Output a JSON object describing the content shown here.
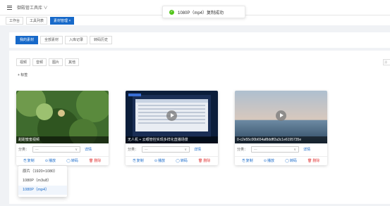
{
  "app": {
    "title": "御殿管工具库 ∨"
  },
  "toast": {
    "icon": "check-circle-icon",
    "text": "1080P（mp4）复制成功"
  },
  "tabs": [
    {
      "label": "工作台",
      "active": false
    },
    {
      "label": "工具列表",
      "active": false
    },
    {
      "label": "素材管理 ×",
      "active": true
    }
  ],
  "subtabs": [
    {
      "label": "我的素材",
      "active": true
    },
    {
      "label": "全部素材",
      "active": false
    },
    {
      "label": "入库记录",
      "active": false
    },
    {
      "label": "转码历史",
      "active": false
    }
  ],
  "filters": [
    "视频",
    "音频",
    "图片",
    "其他"
  ],
  "search_edge": "添",
  "tag_button": "+ 标签",
  "cards": [
    {
      "caption": "甜甜蜜蜜视频",
      "class_label": "分类：",
      "select_value": "—",
      "detail": "详情"
    },
    {
      "caption": "无人机 + 云眼管控实现多样化直播场景",
      "class_label": "分类：",
      "select_value": "—",
      "detail": "详情"
    },
    {
      "caption": "0-c2e55c00b654af8ddff2a3c1e6195735e",
      "class_label": "分类：",
      "select_value": "—",
      "detail": "详情"
    }
  ],
  "actions": {
    "copy": "复制",
    "play": "播放",
    "transcode": "转码",
    "delete": "删除"
  },
  "dropdown": [
    {
      "label": "原片（1920×1080）",
      "selected": false
    },
    {
      "label": "1080P（m3u8）",
      "selected": false
    },
    {
      "label": "1080P（mp4）",
      "selected": true
    }
  ],
  "colors": {
    "primary": "#1769c9",
    "success": "#52c41a",
    "danger": "#e23c3c"
  }
}
